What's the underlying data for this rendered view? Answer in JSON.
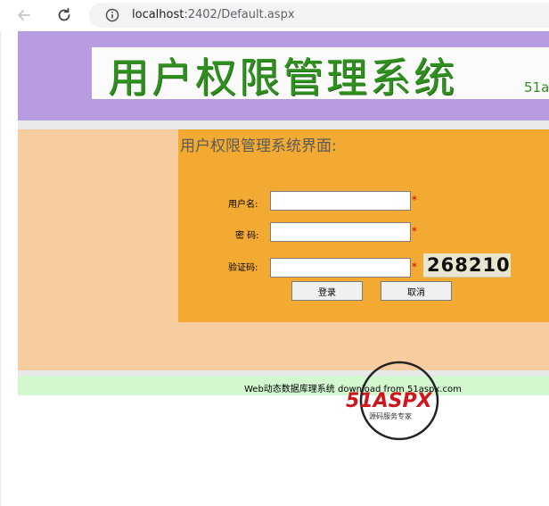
{
  "browser": {
    "url_host": "localhost",
    "url_rest": ":2402/Default.aspx",
    "icons": [
      "back-arrow-icon",
      "reload-icon",
      "info-icon"
    ]
  },
  "banner": {
    "title": "用户权限管理系统",
    "tag": "51a"
  },
  "panel": {
    "title": "用户权限管理系统界面:",
    "username_label": "用户名:",
    "password_label": "密 码:",
    "captcha_label": "验证码:",
    "required_mark": "*",
    "username_value": "",
    "password_value": "",
    "captcha_value": "",
    "captcha_code": "268210",
    "login_button": "登录",
    "cancel_button": "取消"
  },
  "footer": {
    "text": "Web动态数据库理系统 download from 51aspx.com"
  },
  "watermark": {
    "logo": "51ASPX",
    "tagline": "源码服务专家"
  },
  "colors": {
    "banner": "#b89ce2",
    "content": "#f7cd9f",
    "panel": "#f3aa32",
    "footer": "#d3f8d0",
    "title_green": "#2f8f1f",
    "required": "#d40000"
  }
}
